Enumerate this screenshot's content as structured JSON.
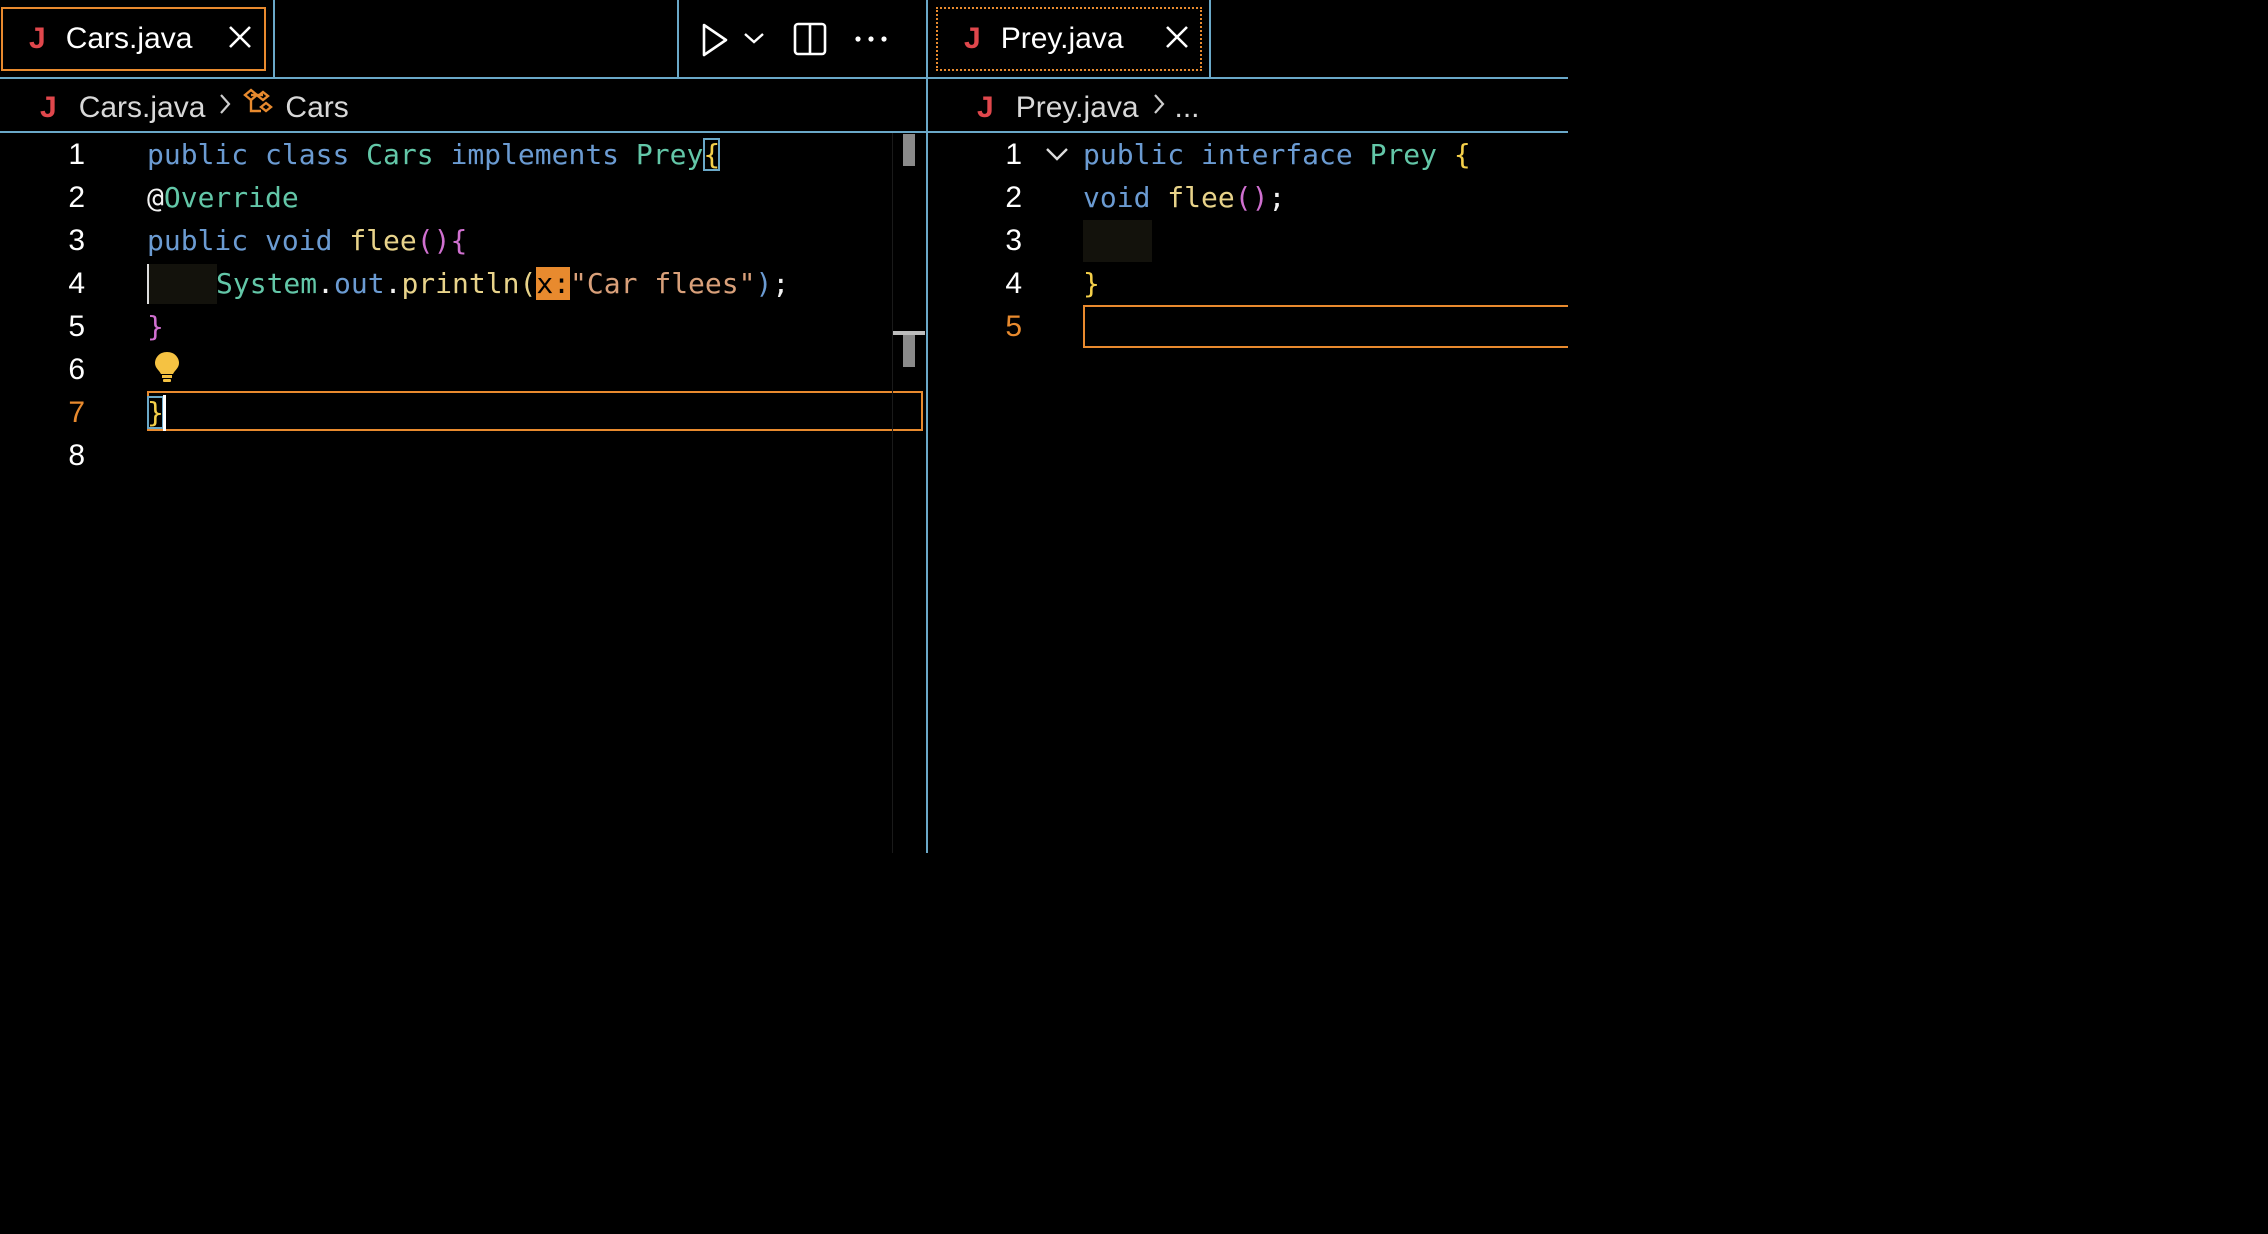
{
  "left_editor": {
    "tab": {
      "label": "Cars.java",
      "icon": "J"
    },
    "breadcrumb": {
      "file": "Cars.java",
      "symbol": "Cars"
    },
    "line_numbers": [
      "1",
      "2",
      "3",
      "4",
      "5",
      "6",
      "7",
      "8"
    ],
    "active_line": "7",
    "code": {
      "l1": [
        "public",
        " ",
        "class",
        " ",
        "Cars",
        " ",
        "implements",
        " ",
        "Prey",
        "{"
      ],
      "l2": [
        "@",
        "Override"
      ],
      "l3": [
        "public",
        " ",
        "void",
        " ",
        "flee",
        "(",
        ")",
        "{"
      ],
      "l4": [
        "System",
        ".",
        "out",
        ".",
        "println",
        "(",
        "x:",
        "\"Car flees\"",
        ")",
        ";"
      ],
      "l5": [
        "}"
      ],
      "l7": [
        "}"
      ]
    }
  },
  "right_editor": {
    "tab": {
      "label": "Prey.java",
      "icon": "J"
    },
    "breadcrumb": {
      "file": "Prey.java",
      "more": "..."
    },
    "line_numbers": [
      "1",
      "2",
      "3",
      "4",
      "5"
    ],
    "active_line": "5",
    "code": {
      "l1": [
        "public",
        " ",
        "interface",
        " ",
        "Prey",
        " ",
        "{"
      ],
      "l2": [
        "void",
        " ",
        "flee",
        "(",
        ")",
        ";"
      ],
      "l4": [
        "}"
      ]
    }
  },
  "toolbar": {
    "run_icon": "play-icon",
    "run_menu_icon": "chevron-down-icon",
    "split_icon": "split-editor-icon",
    "more_icon": "ellipsis-icon"
  },
  "colors": {
    "accent": "#e88a2e",
    "keyword": "#6b9bd2",
    "type": "#63c7a8",
    "function": "#e8d38a",
    "string": "#d9a07a",
    "bracket": "#f5d04a",
    "paren": "#d070d0",
    "java_icon": "#e0474c"
  }
}
